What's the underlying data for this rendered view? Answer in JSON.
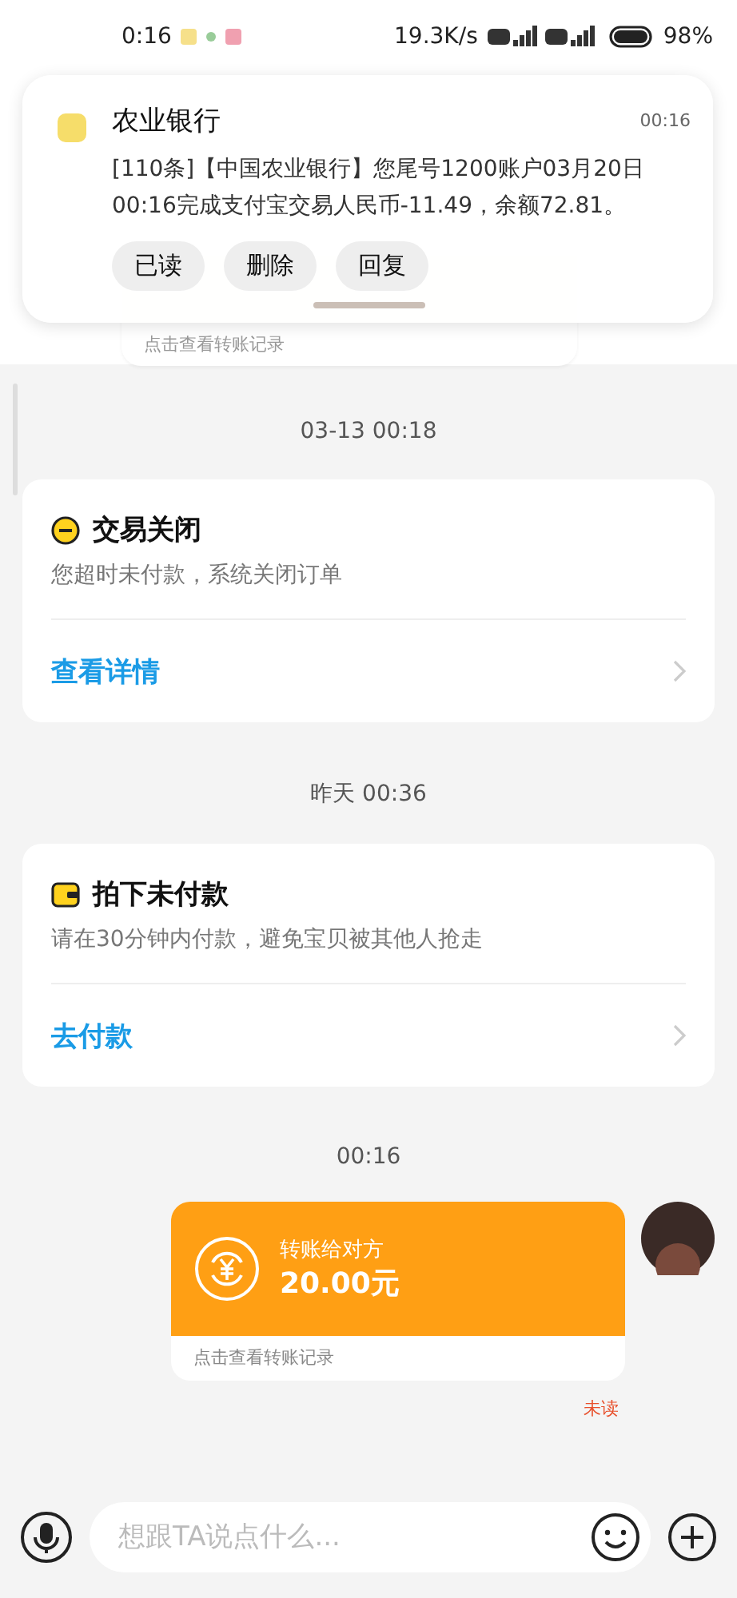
{
  "status_bar": {
    "time": "0:16",
    "speed": "19.3K/s",
    "battery": "98%"
  },
  "notification": {
    "app": "农业银行",
    "time": "00:16",
    "body": "[110条]【中国农业银行】您尾号1200账户03月20日00:16完成支付宝交易人民币-11.49，余额72.81。",
    "actions": [
      "已读",
      "删除",
      "回复"
    ]
  },
  "top_transfer": {
    "footer": "点击查看转账记录"
  },
  "messages": [
    {
      "kind": "time",
      "text": "03-13 00:18"
    },
    {
      "kind": "closed",
      "title": "交易关闭",
      "subtitle": "您超时未付款，系统关闭订单",
      "action": "查看详情"
    },
    {
      "kind": "time",
      "text": "昨天 00:36"
    },
    {
      "kind": "unpaid",
      "title": "拍下未付款",
      "subtitle": "请在30分钟内付款，避免宝贝被其他人抢走",
      "action": "去付款"
    },
    {
      "kind": "time",
      "text": "00:16"
    },
    {
      "kind": "transfer",
      "label": "转账给对方",
      "amount": "20.00元",
      "footer": "点击查看转账记录",
      "status": "未读"
    }
  ],
  "input": {
    "placeholder": "想跟TA说点什么..."
  }
}
